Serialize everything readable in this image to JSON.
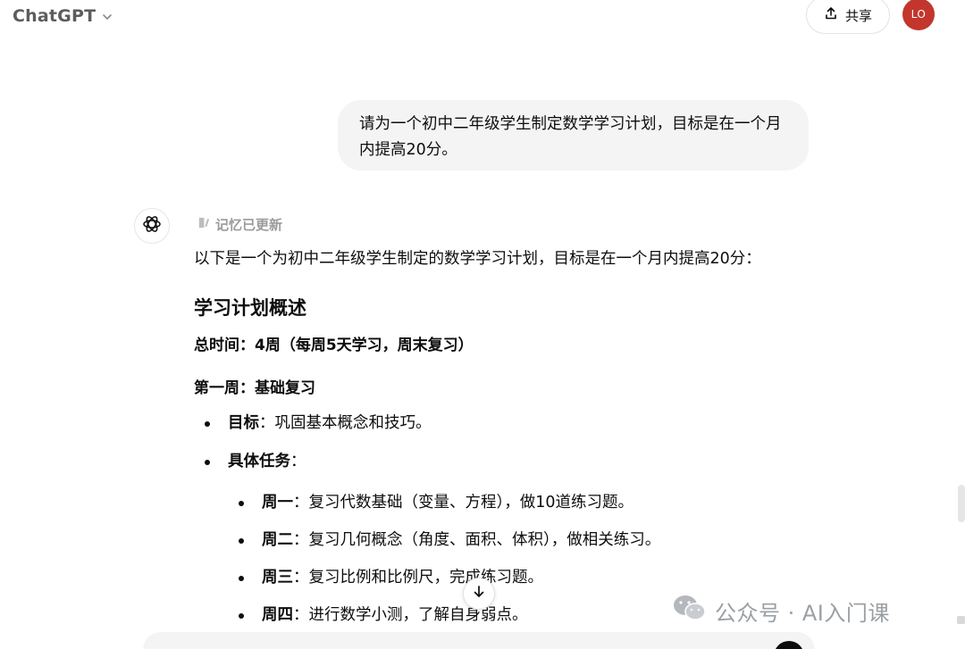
{
  "header": {
    "app_title": "ChatGPT",
    "share_label": "共享",
    "avatar_initials": "LO",
    "avatar_color": "#c2362d"
  },
  "user_message": "请为一个初中二年级学生制定数学学习计划，目标是在一个月内提高20分。",
  "assistant": {
    "memory_label": "记忆已更新",
    "intro": "以下是一个为初中二年级学生制定的数学学习计划，目标是在一个月内提高20分：",
    "overview_heading": "学习计划概述",
    "total_time": "总时间：4周（每周5天学习，周末复习）",
    "week1_heading": "第一周：基础复习",
    "goal_label": "目标",
    "goal_text": "：巩固基本概念和技巧。",
    "tasks_label": "具体任务",
    "tasks_suffix": "：",
    "days": [
      {
        "label": "周一",
        "text": "：复习代数基础（变量、方程），做10道练习题。"
      },
      {
        "label": "周二",
        "text": "：复习几何概念（角度、面积、体积），做相关练习。"
      },
      {
        "label": "周三",
        "text": "：复习比例和比例尺，完成练习题。"
      },
      {
        "label": "周四",
        "text": "：进行数学小测，了解自身弱点。"
      }
    ]
  },
  "watermark": "公众号 · AI入门课",
  "icons": {
    "title_chevron": "chevron-down-icon",
    "share": "share-icon",
    "assistant": "openai-logo-icon",
    "memory": "memory-edit-icon",
    "scroll": "arrow-down-icon",
    "watermark": "wechat-icon"
  },
  "colors": {
    "bubble_bg": "#f4f4f4",
    "muted_text": "#9b9b9b",
    "title_text": "#5d5d5d"
  }
}
